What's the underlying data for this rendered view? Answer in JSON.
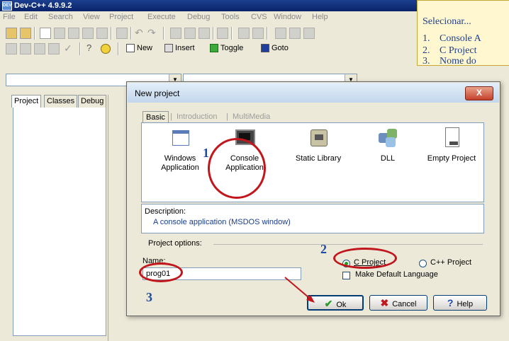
{
  "window": {
    "title": "Dev-C++ 4.9.9.2"
  },
  "menu": [
    "File",
    "Edit",
    "Search",
    "View",
    "Project",
    "Execute",
    "Debug",
    "Tools",
    "CVS",
    "Window",
    "Help"
  ],
  "toolbar": {
    "new_label": "New",
    "insert_label": "Insert",
    "toggle_label": "Toggle",
    "goto_label": "Goto"
  },
  "left_tabs": [
    "Project",
    "Classes",
    "Debug"
  ],
  "instructions": {
    "heading": "Selecionar...",
    "steps": [
      {
        "num": "1.",
        "text": "Console A"
      },
      {
        "num": "2.",
        "text": "C Project"
      },
      {
        "num": "3.",
        "text": "Nome do"
      }
    ]
  },
  "dialog": {
    "title": "New project",
    "close": "X",
    "tabs": [
      "Basic",
      "Introduction",
      "MultiMedia"
    ],
    "project_types": [
      {
        "line1": "Windows",
        "line2": "Application",
        "icon": "windows-app-icon"
      },
      {
        "line1": "Console",
        "line2": "Application",
        "icon": "console-app-icon"
      },
      {
        "line1": "Static Library",
        "line2": "",
        "icon": "static-lib-icon"
      },
      {
        "line1": "DLL",
        "line2": "",
        "icon": "dll-icon"
      },
      {
        "line1": "Empty Project",
        "line2": "",
        "icon": "empty-project-icon"
      }
    ],
    "description_label": "Description:",
    "description_text": "A console application (MSDOS window)",
    "options_label": "Project options:",
    "name_label": "Name:",
    "name_value": "prog01",
    "radio_c": "C Project",
    "radio_cpp": "C++ Project",
    "make_default": "Make Default Language",
    "ok_label": "Ok",
    "cancel_label": "Cancel",
    "help_label": "Help"
  },
  "callouts": {
    "one": "1",
    "two": "2",
    "three": "3"
  },
  "colors": {
    "accent": "#1a4ba8",
    "highlight": "#c0161c",
    "note_bg": "#fff7cf"
  }
}
